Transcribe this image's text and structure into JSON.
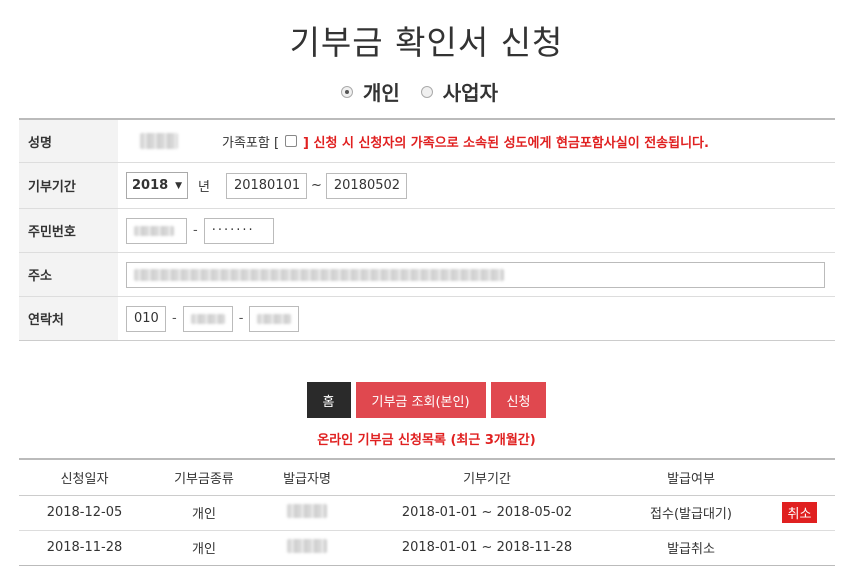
{
  "page": {
    "title": "기부금 확인서 신청"
  },
  "applicant_type": {
    "options": [
      {
        "label": "개인",
        "checked": true
      },
      {
        "label": "사업자",
        "checked": false
      }
    ]
  },
  "form": {
    "name": {
      "label": "성명",
      "family_prefix": "가족포함 [",
      "family_notice": "] 신청 시 신청자의 가족으로 소속된 성도에게 현금포함사실이 전송됩니다."
    },
    "period": {
      "label": "기부기간",
      "year": "2018",
      "year_suffix": "년",
      "from": "20180101",
      "tilde": "~",
      "to": "20180502"
    },
    "resident_no": {
      "label": "주민번호",
      "dash": "-",
      "second": "·······"
    },
    "address": {
      "label": "주소"
    },
    "phone": {
      "label": "연락처",
      "first": "010",
      "dash1": "-",
      "dash2": "-"
    }
  },
  "buttons": {
    "home": "홈",
    "lookup": "기부금 조회(본인)",
    "apply": "신청"
  },
  "list": {
    "title": "온라인 기부금 신청목록 (최근 3개월간)",
    "columns": [
      "신청일자",
      "기부금종류",
      "발급자명",
      "기부기간",
      "발급여부",
      ""
    ],
    "rows": [
      {
        "date": "2018-12-05",
        "kind": "개인",
        "period": "2018-01-01 ~ 2018-05-02",
        "status": "접수(발급대기)",
        "action": "취소"
      },
      {
        "date": "2018-11-28",
        "kind": "개인",
        "period": "2018-01-01 ~ 2018-11-28",
        "status": "발급취소",
        "action": ""
      }
    ]
  },
  "colors": {
    "accent_red": "#e02020",
    "button_red": "#e0484f",
    "button_dark": "#2a2a2a"
  }
}
